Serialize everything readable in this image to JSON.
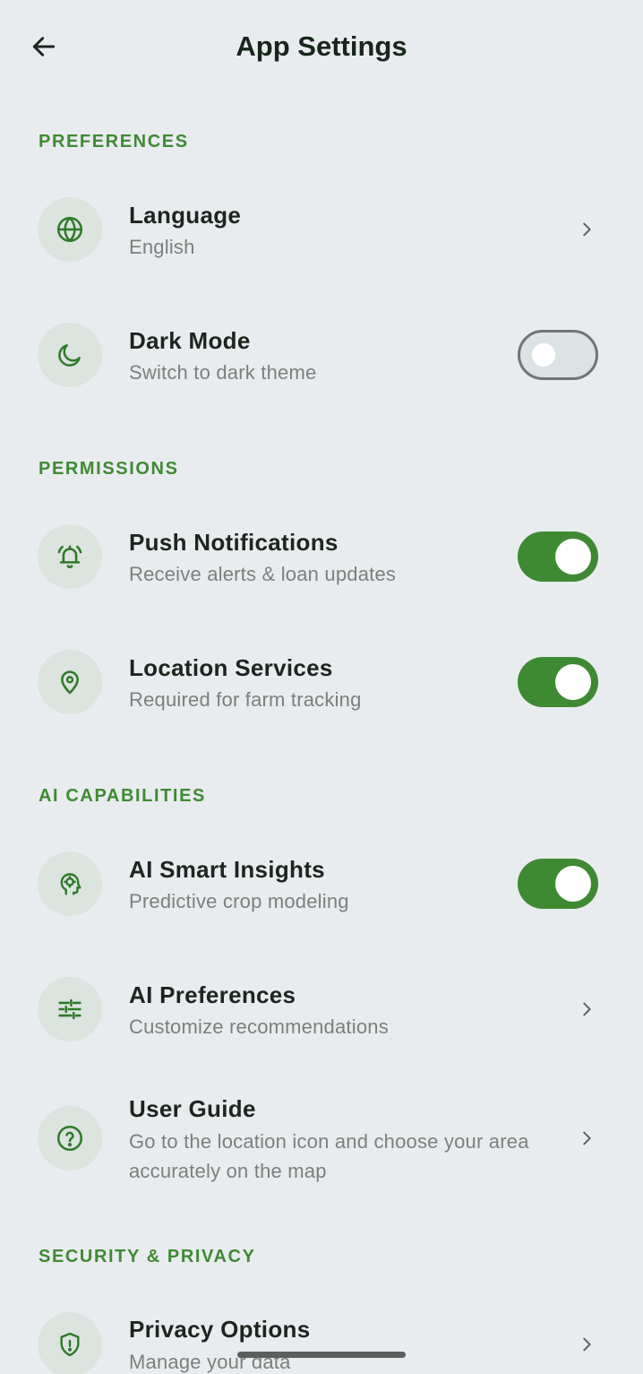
{
  "header": {
    "title": "App Settings",
    "back_icon": "arrow-left-icon"
  },
  "sections": {
    "preferences": {
      "title": "PREFERENCES"
    },
    "permissions": {
      "title": "PERMISSIONS"
    },
    "ai": {
      "title": "AI CAPABILITIES"
    },
    "security": {
      "title": "SECURITY & PRIVACY"
    }
  },
  "rows": {
    "language": {
      "title": "Language",
      "subtitle": "English",
      "icon": "globe-icon"
    },
    "dark_mode": {
      "title": "Dark Mode",
      "subtitle": "Switch to dark theme",
      "icon": "moon-icon",
      "enabled": false
    },
    "push_notifications": {
      "title": "Push Notifications",
      "subtitle": "Receive alerts & loan updates",
      "icon": "bell-ringing-icon",
      "enabled": true
    },
    "location_services": {
      "title": "Location Services",
      "subtitle": "Required for farm tracking",
      "icon": "map-pin-icon",
      "enabled": true
    },
    "ai_smart_insights": {
      "title": "AI Smart Insights",
      "subtitle": "Predictive crop modeling",
      "icon": "head-brain-icon",
      "enabled": true
    },
    "ai_preferences": {
      "title": "AI Preferences",
      "subtitle": "Customize recommendations",
      "icon": "sliders-icon"
    },
    "user_guide": {
      "title": "User Guide",
      "subtitle": "Go to the location icon and choose your area accurately on the map",
      "icon": "help-circle-icon"
    },
    "privacy_options": {
      "title": "Privacy Options",
      "subtitle": "Manage your data",
      "icon": "shield-icon"
    }
  },
  "colors": {
    "accent": "#3e8a33",
    "section_header": "#3f8a34",
    "background": "#e9ecee",
    "icon_bg": "#dbe4de"
  }
}
